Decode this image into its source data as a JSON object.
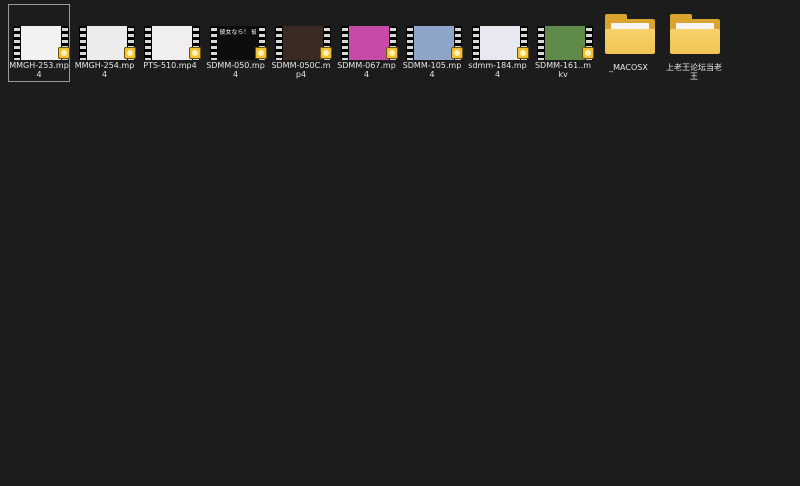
{
  "files": [
    {
      "name": "MMGH-253.mp4",
      "selected": true,
      "thumb_color": "#f2f2f2",
      "caption": ""
    },
    {
      "name": "MMGH-254.mp4",
      "selected": false,
      "thumb_color": "#ececec",
      "caption": ""
    },
    {
      "name": "PTS-510.mp4",
      "selected": false,
      "thumb_color": "#f0eeee",
      "caption": ""
    },
    {
      "name": "SDMM-050.mp4",
      "selected": false,
      "thumb_color": "#0d0d0d",
      "caption": "彼女なら！ 彼氏のチンボ"
    },
    {
      "name": "SDMM-050C.mp4",
      "selected": false,
      "thumb_color": "#3a2a22",
      "caption": ""
    },
    {
      "name": "SDMM-067.mp4",
      "selected": false,
      "thumb_color": "#c84aa8",
      "caption": ""
    },
    {
      "name": "SDMM-105.mp4",
      "selected": false,
      "thumb_color": "#8ea4c8",
      "caption": ""
    },
    {
      "name": "sdmm-184.mp4",
      "selected": false,
      "thumb_color": "#e8e8f0",
      "caption": ""
    },
    {
      "name": "SDMM-161..mkv",
      "selected": false,
      "thumb_color": "#5f8a4a",
      "caption": ""
    }
  ],
  "folders": [
    {
      "name": "_MACOSX"
    },
    {
      "name": "上老王论坛当老王"
    }
  ],
  "colors": {
    "background": "#1c1c1c",
    "folder_accent": "#efc453",
    "badge": "#f2c230"
  },
  "icons": {
    "video": "film-strip-icon",
    "badge": "video-player-badge-icon",
    "folder": "folder-icon"
  }
}
